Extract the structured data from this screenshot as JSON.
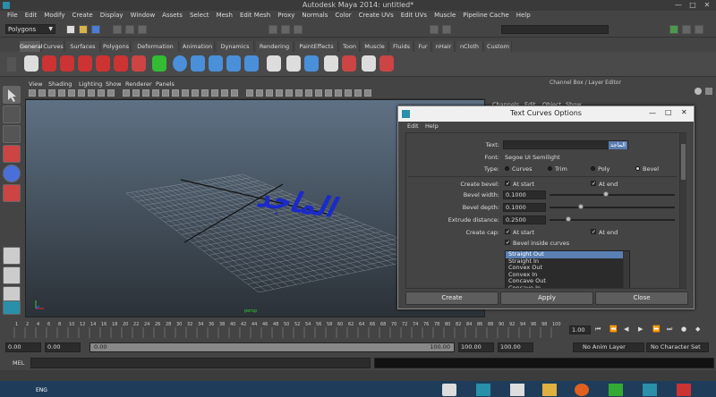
{
  "window": {
    "title": "Autodesk Maya 2014: untitled*",
    "minimize": "—",
    "maximize": "□",
    "close": "✕"
  },
  "menubar": [
    "File",
    "Edit",
    "Modify",
    "Create",
    "Display",
    "Window",
    "Assets",
    "Select",
    "Mesh",
    "Edit Mesh",
    "Proxy",
    "Normals",
    "Color",
    "Create UVs",
    "Edit UVs",
    "Muscle",
    "Pipeline Cache",
    "Help"
  ],
  "status_line": {
    "mode": "Polygons"
  },
  "shelf_tabs": [
    "General",
    "Curves",
    "Surfaces",
    "Polygons",
    "Deformation",
    "Animation",
    "Dynamics",
    "Rendering",
    "PaintEffects",
    "Toon",
    "Muscle",
    "Fluids",
    "Fur",
    "nHair",
    "nCloth",
    "Custom"
  ],
  "shelf_active": "General",
  "panel_menu": [
    "View",
    "Shading",
    "Lighting",
    "Show",
    "Renderer",
    "Panels"
  ],
  "viewport": {
    "text_object": "الماجد",
    "camera_label": "persp"
  },
  "right_panel": {
    "title": "Channel Box / Layer Editor",
    "menus": [
      "Channels",
      "Edit",
      "Object",
      "Show"
    ]
  },
  "dialog": {
    "title": "Text Curves Options",
    "menu": [
      "Edit",
      "Help"
    ],
    "text_label": "Text:",
    "text_value": "الماجد",
    "font_label": "Font:",
    "font_value": "Segoe UI Semilight",
    "type_label": "Type:",
    "type_options": [
      "Curves",
      "Trim",
      "Poly",
      "Bevel"
    ],
    "type_selected": "Bevel",
    "create_bevel_label": "Create bevel:",
    "at_start": "At start",
    "at_end": "At end",
    "bevel_width_label": "Bevel width:",
    "bevel_width": "0.1000",
    "bevel_depth_label": "Bevel depth:",
    "bevel_depth": "0.1000",
    "extrude_distance_label": "Extrude distance:",
    "extrude_distance": "0.2500",
    "create_cap_label": "Create cap:",
    "cap_at_start": "At start",
    "cap_at_end": "At end",
    "bevel_inside": "Bevel inside curves",
    "bevel_styles": [
      "Straight Out",
      "Straight In",
      "Convex Out",
      "Convex In",
      "Concave Out",
      "Concave In"
    ],
    "bevel_style_selected": "Straight Out",
    "buttons": {
      "create": "Create",
      "apply": "Apply",
      "close": "Close"
    }
  },
  "timeline": {
    "ticks": [
      "1",
      "2",
      "4",
      "6",
      "8",
      "10",
      "12",
      "14",
      "16",
      "18",
      "20",
      "22",
      "24",
      "26",
      "28",
      "30",
      "32",
      "34",
      "36",
      "38",
      "40",
      "42",
      "44",
      "46",
      "48",
      "50",
      "52",
      "54",
      "56",
      "58",
      "60",
      "62",
      "64",
      "66",
      "68",
      "70",
      "72",
      "74",
      "76",
      "78",
      "80",
      "82",
      "84",
      "86",
      "88",
      "90",
      "92",
      "94",
      "96",
      "98",
      "100"
    ],
    "current_frame": "1.00"
  },
  "range": {
    "start": "0.00",
    "playback_start": "0.00",
    "range_start": "0.00",
    "range_end": "100.00",
    "playback_end": "100.00",
    "end": "100.00",
    "anim_layer": "No Anim Layer",
    "character_set": "No Character Set"
  },
  "command_line": {
    "label": "MEL"
  },
  "taskbar": {
    "language": "ENG"
  }
}
